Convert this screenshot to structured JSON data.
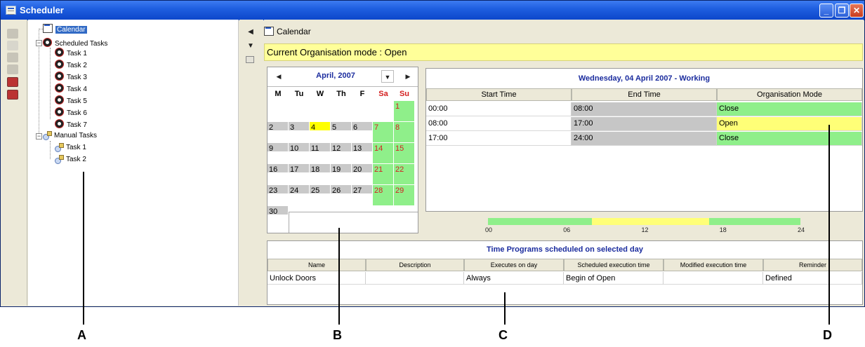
{
  "window": {
    "title": "Scheduler",
    "controls": {
      "minimize": "_",
      "restore": "❐",
      "close": "✕"
    }
  },
  "tree": {
    "calendar_label": "Calendar",
    "scheduled_label": "Scheduled Tasks",
    "scheduled_tasks": [
      "Task 1",
      "Task 2",
      "Task 3",
      "Task 4",
      "Task 5",
      "Task 6",
      "Task 7"
    ],
    "manual_label": "Manual Tasks",
    "manual_tasks": [
      "Task 1",
      "Task 2"
    ]
  },
  "main": {
    "header_label": "Calendar",
    "mode_banner": "Current Organisation mode : Open"
  },
  "calendar": {
    "month_label": "April, 2007",
    "day_headers": [
      "M",
      "Tu",
      "W",
      "Th",
      "F",
      "Sa",
      "Su"
    ],
    "weeks": [
      [
        "",
        "",
        "",
        "",
        "",
        "",
        "1"
      ],
      [
        "2",
        "3",
        "4",
        "5",
        "6",
        "7",
        "8"
      ],
      [
        "9",
        "10",
        "11",
        "12",
        "13",
        "14",
        "15"
      ],
      [
        "16",
        "17",
        "18",
        "19",
        "20",
        "21",
        "22"
      ],
      [
        "23",
        "24",
        "25",
        "26",
        "27",
        "28",
        "29"
      ],
      [
        "30",
        "",
        "",
        "",
        "",
        "",
        ""
      ]
    ],
    "selected_day": "4"
  },
  "day_schedule": {
    "title": "Wednesday, 04 April 2007 - Working",
    "columns": [
      "Start Time",
      "End Time",
      "Organisation Mode"
    ],
    "rows": [
      {
        "start": "00:00",
        "end": "08:00",
        "mode": "Close"
      },
      {
        "start": "08:00",
        "end": "17:00",
        "mode": "Open"
      },
      {
        "start": "17:00",
        "end": "24:00",
        "mode": "Close"
      }
    ]
  },
  "timeline": {
    "labels": [
      "00",
      "06",
      "12",
      "18",
      "24"
    ],
    "segments": [
      {
        "from": 0,
        "to": 8,
        "mode": "Close"
      },
      {
        "from": 8,
        "to": 17,
        "mode": "Open"
      },
      {
        "from": 17,
        "to": 24,
        "mode": "Close"
      }
    ]
  },
  "programs": {
    "title": "Time Programs scheduled on selected day",
    "columns": [
      "Name",
      "Description",
      "Executes on day",
      "Scheduled execution time",
      "Modified execution time",
      "Reminder"
    ],
    "rows": [
      {
        "name": "Unlock Doors",
        "description": "",
        "executes": "Always",
        "scheduled": "Begin of Open",
        "modified": "",
        "reminder": "Defined"
      }
    ]
  },
  "callouts": [
    "A",
    "B",
    "C",
    "D"
  ],
  "colors": {
    "close": "#8fef8a",
    "open": "#ffff77",
    "banner": "#ffff99",
    "accent": "#1b2c9e",
    "weekend": "#d42020"
  }
}
